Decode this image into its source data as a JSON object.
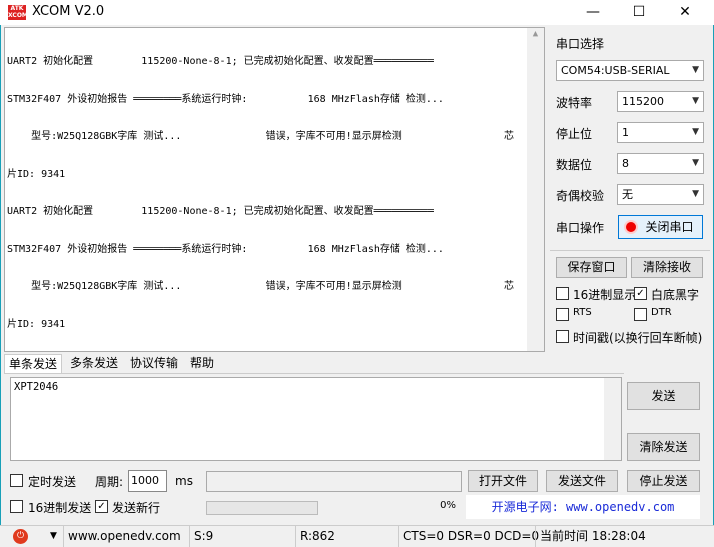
{
  "title": "XCOM V2.0",
  "logo": "ATK XCOM",
  "receive_lines": [
    "UART2 初始化配置        115200-None-8-1; 已完成初始化配置、收发配置══════════",
    "STM32F407 外设初始报告 ════════系统运行时钟:          168 MHzFlash存储 检测...",
    "    型号:W25Q128GBK字库 测试...              错误，字库不可用!显示屏检测                 芯",
    "片ID: 9341",
    "UART2 初始化配置        115200-None-8-1; 已完成初始化配置、收发配置══════════",
    "STM32F407 外设初始报告 ════════系统运行时钟:          168 MHzFlash存储 检测...",
    "    型号:W25Q128GBK字库 测试...              错误，字库不可用!显示屏检测                 芯",
    "片ID: 9341"
  ],
  "panel": {
    "port_label": "串口选择",
    "port_value": "COM54:USB-SERIAL",
    "baud_label": "波特率",
    "baud_value": "115200",
    "stop_label": "停止位",
    "stop_value": "1",
    "data_label": "数据位",
    "data_value": "8",
    "parity_label": "奇偶校验",
    "parity_value": "无",
    "op_label": "串口操作",
    "op_button": "关闭串口",
    "save_window": "保存窗口",
    "clear_recv": "清除接收",
    "hex_display": "16进制显示",
    "white_bg": "白底黑字",
    "rts": "RTS",
    "dtr": "DTR",
    "timestamp": "时间戳(以换行回车断帧)"
  },
  "tabs": [
    "单条发送",
    "多条发送",
    "协议传输",
    "帮助"
  ],
  "send": {
    "text": "XPT2046",
    "send_button": "发送",
    "clear_button": "清除发送",
    "timed_send": "定时发送",
    "period_label": "周期:",
    "period_value": "1000",
    "period_unit": "ms",
    "open_file": "打开文件",
    "send_file": "发送文件",
    "stop_send": "停止发送",
    "hex_send": "16进制发送",
    "send_newline": "发送新行",
    "progress": "0%",
    "ad": "开源电子网: www.openedv.com"
  },
  "status": {
    "site": "www.openedv.com",
    "sent": "S:9",
    "received": "R:862",
    "lines": "CTS=0 DSR=0 DCD=0",
    "time": "当前时间 18:28:04"
  }
}
